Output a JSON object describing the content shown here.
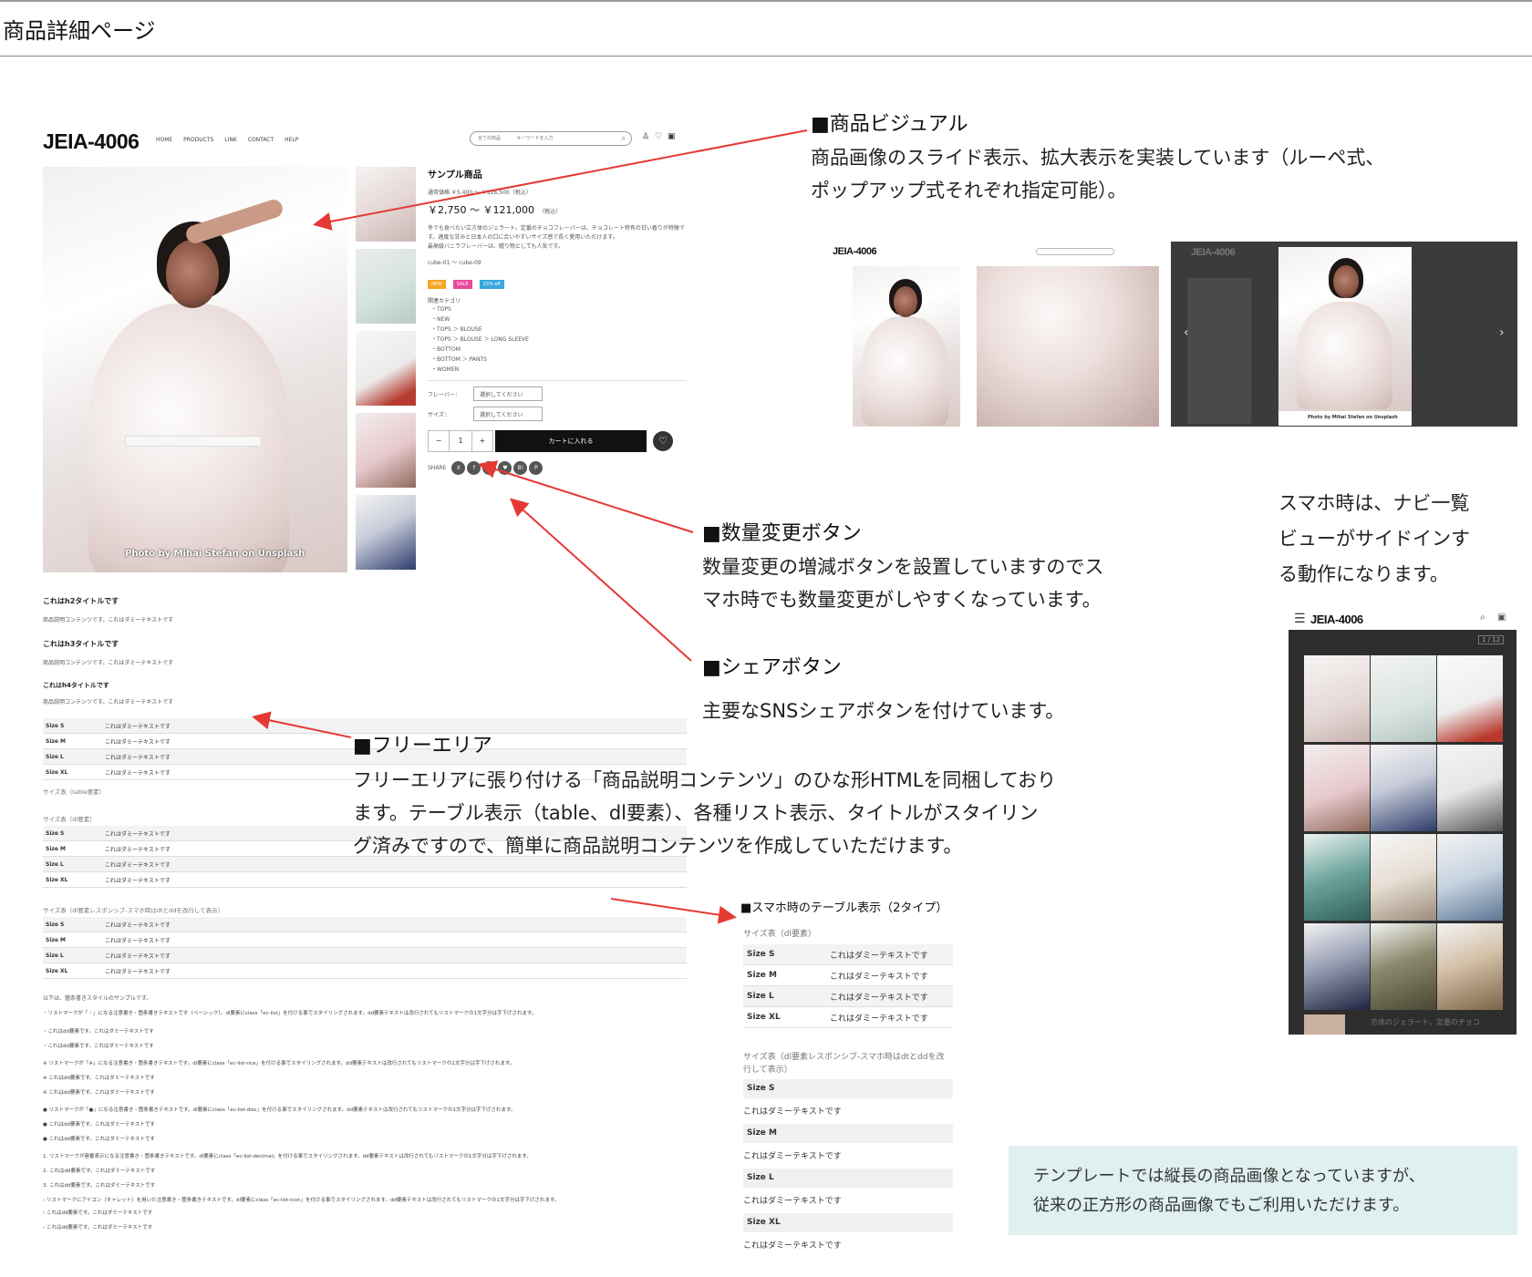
{
  "page": {
    "title": "商品詳細ページ"
  },
  "mock": {
    "logo": "JEIA-4006",
    "nav": [
      "HOME",
      "PRODUCTS",
      "LINK",
      "CONTACT",
      "HELP"
    ],
    "search": {
      "category": "全ての商品",
      "placeholder": "キーワードを入力"
    },
    "photo_credit": "Photo by Mihai Stefan on Unsplash",
    "product": {
      "name": "サンプル商品",
      "regular_price": "通常価格 ￥5,400 〜 ￥126,500（税込）",
      "price": "￥2,750 〜 ￥121,000",
      "tax": "（税込）",
      "desc1": "冬でも食べたい立方体のジェラート。定番のチョコフレーバーは、チョコレート特有の甘い香りが特徴です。適度な甘みと日本人の口に合いやすいサイズ感で長く愛用いただけます。",
      "desc2": "最高級バニラフレーバーは、贈り物としても人気です。",
      "code": "cube-01 〜 cube-09",
      "tags": [
        "NEW",
        "SALE",
        "15% off"
      ],
      "category_label": "関連カテゴリ",
      "categories": [
        "TOPS",
        "NEW",
        "TOPS ＞ BLOUSE",
        "TOPS ＞ BLOUSE ＞ LONG SLEEVE",
        "BOTTOM",
        "BOTTOM ＞ PANTS",
        "WOMEN"
      ],
      "flavor_label": "フレーバー：",
      "size_label": "サイズ：",
      "select_placeholder": "選択してください",
      "qty_minus": "−",
      "qty_value": "1",
      "qty_plus": "+",
      "cart_label": "カートに入れる",
      "share_label": "SHARE",
      "share_icons": [
        "X",
        "f",
        "●",
        "♥",
        "B!",
        "P"
      ]
    },
    "free_area": {
      "h2": "これはh2タイトルです",
      "h3": "これはh3タイトルです",
      "h4": "これはh4タイトルです",
      "body": "商品説明コンテンツです。これはダミーテキストです",
      "sizes": [
        "Size S",
        "Size M",
        "Size L",
        "Size XL"
      ],
      "dummy": "これはダミーテキストです",
      "caption_table": "サイズ表（table要素）",
      "caption_dl": "サイズ表（dl要素）",
      "caption_dl_resp": "サイズ表（dl要素レスポンシブ-スマホ時はdtとddを改行して表示）",
      "list_intro": "以下は、箇条書きスタイルのサンプルです。",
      "list_dot": "・リストマークが「・」になる注意書き・箇条書きテキストです（ベーシック）。dl要素にclass「ec-list」を付ける事でスタイリングされます。dd要素テキストは改行されてもリストマークの1文字分は字下げされます。",
      "list_rice": "※ リストマークが「※」になる注意書き・箇条書きテキストです。dl要素にclass「ec-list-rice」を付ける事でスタイリングされます。dd要素テキストは改行されてもリストマークの1文字分は字下げされます。",
      "list_disc": "● リストマークが「●」になる注意書き・箇条書きテキストです。dl要素にclass「ec-list-disc」を付ける事でスタイリングされます。dd要素テキストは改行されてもリストマークの1文字分は字下げされます。",
      "list_decimal": "1. リストマークが連番表示になる注意書き・箇条書きテキストです。dl要素にclass「ec-list-decimal」を付ける事でスタイリングされます。dd要素テキストは改行されてもリストマークの1文字分は字下げされます。",
      "list_icon": "› リストマークにアイコン（キャレット）を用いた注意書き・箇条書きテキストです。dl要素にclass「ec-list-icon」を付ける事でスタイリングされます。dd要素テキストは改行されてもリストマークの1文字分は字下げされます。",
      "list_item": "これはdd要素です。これはダミーテキストです"
    }
  },
  "annotations": {
    "visual_title": "■商品ビジュアル",
    "visual_text": [
      "商品画像のスライド表示、拡大表示を実装しています（ルーペ式、",
      "ポップアップ式それぞれ指定可能）。"
    ],
    "qty_title": "■数量変更ボタン",
    "qty_text": [
      "数量変更の増減ボタンを設置していますのでス",
      "マホ時でも数量変更がしやすくなっています。"
    ],
    "share_title": "■シェアボタン",
    "share_text": "主要なSNSシェアボタンを付けています。",
    "free_title": "■フリーエリア",
    "free_text": [
      "フリーエリアに張り付ける「商品説明コンテンツ」のひな形HTMLを同梱しており",
      "ます。テーブル表示（table、dl要素）、各種リスト表示、タイトルがスタイリン",
      "グ済みですので、簡単に商品説明コンテンツを作成していただけます。"
    ],
    "sp_nav_text": [
      "スマホ時は、ナビ一覧",
      "ビューがサイドインす",
      "る動作になります。"
    ],
    "sp_table_title": "■スマホ時のテーブル表示（2タイプ）",
    "sp_caption_dl": "サイズ表（dl要素）",
    "sp_caption_resp": [
      "サイズ表（dl要素レスポンシブ-スマホ時はdtとddを改",
      "行して表示）"
    ],
    "note": [
      "テンプレートでは縦長の商品画像となっていますが、",
      "従来の正方形の商品画像でもご利用いただけます。"
    ]
  },
  "sp_mock": {
    "logo": "JEIA-4006",
    "counter": "1 / 12",
    "caption": "方体のジェラート。定番のチョコ"
  },
  "colors": {
    "accent_red": "#e53935",
    "tag_new": "#f5a623",
    "tag_sale": "#e94b9c",
    "tag_off": "#3aa7e0",
    "note_bg": "#dff0ef"
  }
}
